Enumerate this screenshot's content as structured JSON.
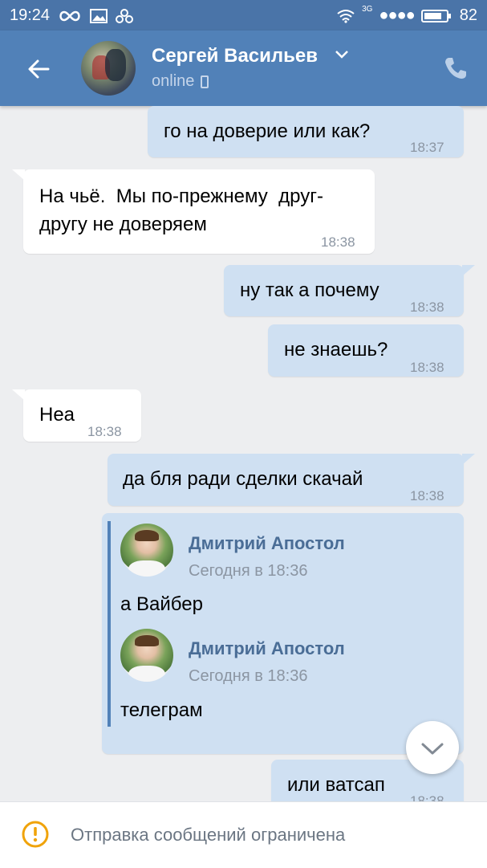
{
  "status_bar": {
    "time": "19:24",
    "signal_type": "3G",
    "battery": "82"
  },
  "header": {
    "contact_name": "Сергей Васильев",
    "status": "online"
  },
  "messages": [
    {
      "text": "го на доверие или как?",
      "time": "18:37"
    },
    {
      "line1": "На чьё.  Мы по-прежнему  друг-",
      "line2": "другу не доверяем",
      "time": "18:38"
    },
    {
      "text": "ну так а почему",
      "time": "18:38"
    },
    {
      "text": "не знаешь?",
      "time": "18:38"
    },
    {
      "text": "Неа",
      "time": "18:38"
    },
    {
      "text": "да бля ради сделки скачай",
      "time": "18:38"
    },
    {
      "forwarded": [
        {
          "author": "Дмитрий Апостол",
          "date": "Сегодня в 18:36",
          "text": "а Вайбер"
        },
        {
          "author": "Дмитрий Апостол",
          "date": "Сегодня в 18:36",
          "text": "телеграм"
        }
      ]
    },
    {
      "text": "или ватсап",
      "time": "18:38"
    }
  ],
  "bottom_bar": {
    "notice": "Отправка сообщений ограничена"
  },
  "colors": {
    "header": "#5181b8",
    "status_bar": "#4a74a8",
    "outgoing": "#cfe0f2",
    "incoming": "#ffffff",
    "warning": "#f0a30a"
  }
}
